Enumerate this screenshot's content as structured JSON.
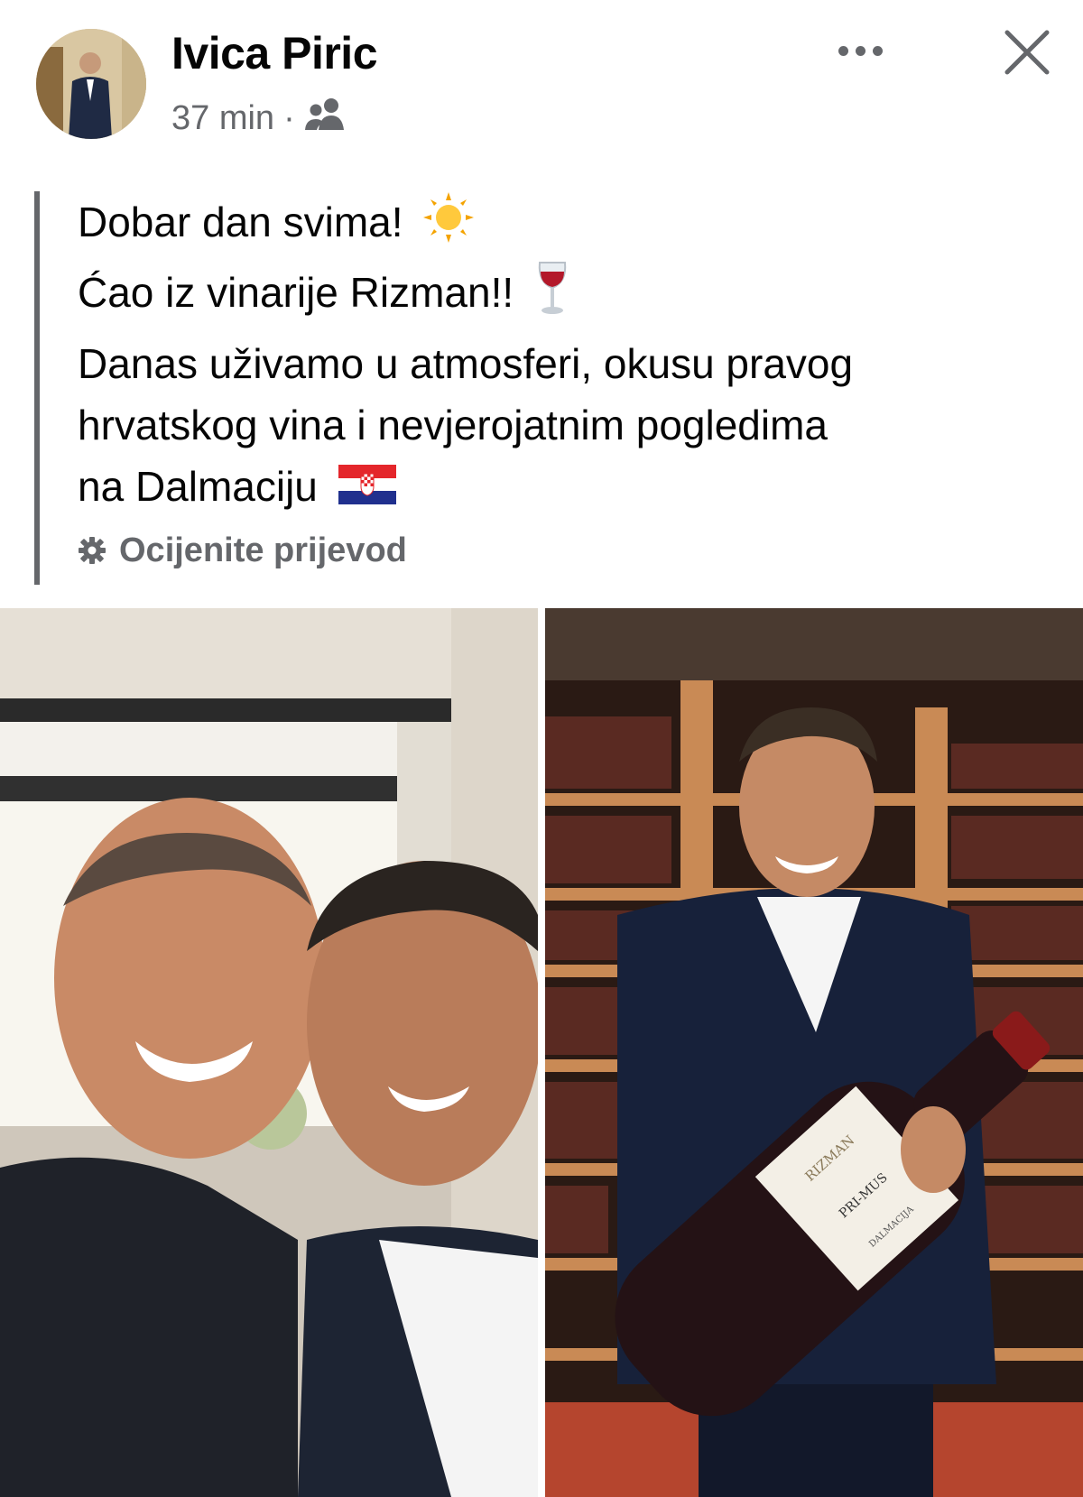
{
  "post": {
    "author": "Ivica Piric",
    "time": "37 min",
    "separator": "·",
    "audience_icon": "friends-icon",
    "lines": [
      "Dobar dan svima!",
      "Ćao iz vinarije Rizman!!",
      "Danas uživamo u atmosferi, okusu pravog",
      "hrvatskog vina i nevjerojatnim pogledima",
      "na Dalmaciju"
    ],
    "translate_label": "Ocijenite prijevod"
  },
  "photos": {
    "left": {
      "description_icon": "selfie-photo"
    },
    "right": {
      "label_brand": "RIZMAN",
      "label_name": "PRI-MUS",
      "label_region": "DALMACIJA"
    }
  },
  "colors": {
    "text": "#050505",
    "secondary": "#65676b",
    "background": "#ffffff"
  }
}
